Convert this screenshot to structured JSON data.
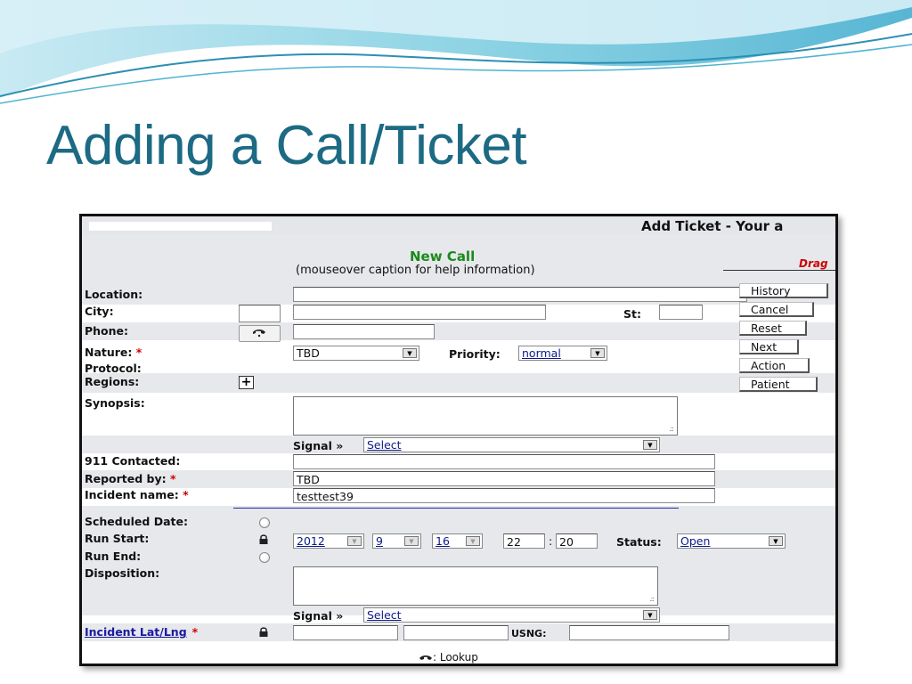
{
  "slide": {
    "title": "Adding a Call/Ticket"
  },
  "ticket": {
    "header_title": "Add Ticket - Your a",
    "heading": "New Call",
    "subheading": "(mouseover caption for help information)",
    "drag_label": "Drag",
    "labels": {
      "location": "Location:",
      "city": "City:",
      "st": "St:",
      "phone": "Phone:",
      "nature": "Nature:",
      "priority": "Priority:",
      "protocol": "Protocol:",
      "regions": "Regions:",
      "synopsis": "Synopsis:",
      "signal": "Signal »",
      "contacted_911": "911 Contacted:",
      "reported_by": "Reported by:",
      "incident_name": "Incident name:",
      "scheduled_date": "Scheduled Date:",
      "run_start": "Run Start:",
      "status": "Status:",
      "run_end": "Run End:",
      "disposition": "Disposition:",
      "incident_latlng": "Incident Lat/Lng",
      "usng": "USNG:",
      "lookup": ": Lookup",
      "required_mark": "*"
    },
    "values": {
      "nature": "TBD",
      "priority": "normal",
      "signal": "Select",
      "signal2": "Select",
      "reported_by": "TBD",
      "incident_name": "testtest39",
      "year": "2012",
      "month": "9",
      "day": "16",
      "hour": "22",
      "minute": "20",
      "time_sep": ":",
      "status": "Open"
    },
    "buttons": [
      "History",
      "Cancel",
      "Reset",
      "Next",
      "Action",
      "Patient"
    ],
    "regions_toggle": "+"
  },
  "colors": {
    "title": "#1c6a84",
    "heading": "#1a8a1a",
    "drag": "#cc0000",
    "row_shade": "#e6e8ec",
    "link": "#1a1aa0"
  }
}
